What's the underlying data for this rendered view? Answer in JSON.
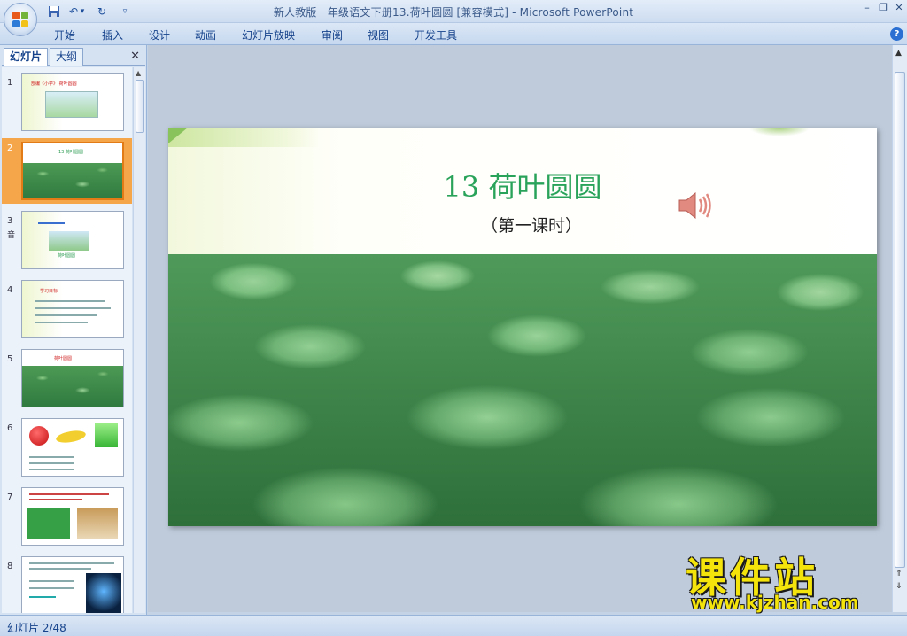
{
  "window": {
    "title": "新人教版一年级语文下册13.荷叶圆圆 [兼容模式] - Microsoft PowerPoint",
    "minimize_glyph": "–",
    "restore_glyph": "❐",
    "close_glyph": "✕"
  },
  "qat": {
    "save_icon": "save-icon",
    "undo_icon": "undo-icon",
    "redo_icon": "redo-icon",
    "undo_glyph": "↶",
    "dropdown_glyph": "▾",
    "redo_glyph": "↻",
    "customize_glyph": "▿"
  },
  "ribbon": {
    "tabs": [
      "开始",
      "插入",
      "设计",
      "动画",
      "幻灯片放映",
      "审阅",
      "视图",
      "开发工具"
    ],
    "help_glyph": "?"
  },
  "panel": {
    "tabs": [
      "幻灯片",
      "大纲"
    ],
    "close_glyph": "✕",
    "thumbnails": [
      {
        "num": "1",
        "caption": "部编《小学》 荷叶圆圆"
      },
      {
        "num": "2",
        "caption": "13 荷叶圆圆"
      },
      {
        "num": "3",
        "caption": "荷叶圆圆"
      },
      {
        "num": "4",
        "caption": "学习目标"
      },
      {
        "num": "5",
        "caption": "荷叶圆圆"
      },
      {
        "num": "6",
        "caption": ""
      },
      {
        "num": "7",
        "caption": ""
      },
      {
        "num": "8",
        "caption": ""
      }
    ],
    "thumb3_side_note": "音"
  },
  "slide": {
    "title": "13 荷叶圆圆",
    "subtitle": "（第一课时）",
    "speaker_icon": "speaker-icon"
  },
  "statusbar": {
    "text": "幻灯片 2/48"
  },
  "watermark": {
    "big": "课件站",
    "url": "www.kjzhan.com"
  },
  "colors": {
    "title_green": "#2aa35a",
    "selected_thumb": "#f5a64a",
    "ribbon_text": "#15428b"
  }
}
